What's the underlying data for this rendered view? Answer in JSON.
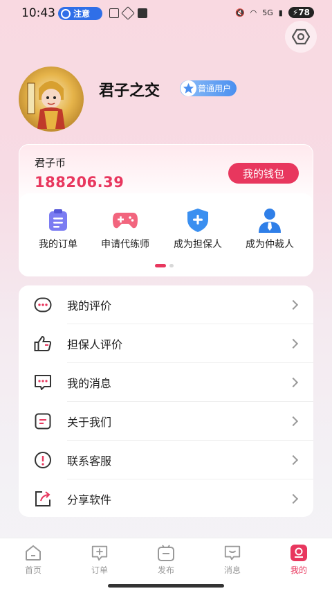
{
  "status_bar": {
    "time": "10:43",
    "notice": "注意",
    "network": "5G",
    "battery": "78"
  },
  "profile": {
    "name": "君子之交",
    "badge": "普通用户"
  },
  "wallet": {
    "label": "君子币",
    "amount": "188206.39",
    "button": "我的钱包"
  },
  "quick_actions": [
    {
      "label": "我的订单",
      "icon": "order-clipboard-icon"
    },
    {
      "label": "申请代练师",
      "icon": "gamepad-icon"
    },
    {
      "label": "成为担保人",
      "icon": "shield-plus-icon"
    },
    {
      "label": "成为仲裁人",
      "icon": "arbiter-person-icon"
    }
  ],
  "menu": [
    {
      "label": "我的评价",
      "icon": "comment-dots-icon"
    },
    {
      "label": "担保人评价",
      "icon": "thumbs-up-icon"
    },
    {
      "label": "我的消息",
      "icon": "message-icon"
    },
    {
      "label": "关于我们",
      "icon": "info-card-icon"
    },
    {
      "label": "联系客服",
      "icon": "alert-circle-icon"
    },
    {
      "label": "分享软件",
      "icon": "share-icon"
    }
  ],
  "tabs": [
    {
      "label": "首页",
      "icon": "home-icon"
    },
    {
      "label": "订单",
      "icon": "order-icon"
    },
    {
      "label": "发布",
      "icon": "publish-icon"
    },
    {
      "label": "消息",
      "icon": "chat-icon"
    },
    {
      "label": "我的",
      "icon": "profile-icon",
      "active": true
    }
  ],
  "colors": {
    "accent": "#e8375e",
    "badge_blue": "#4a8ff0"
  }
}
